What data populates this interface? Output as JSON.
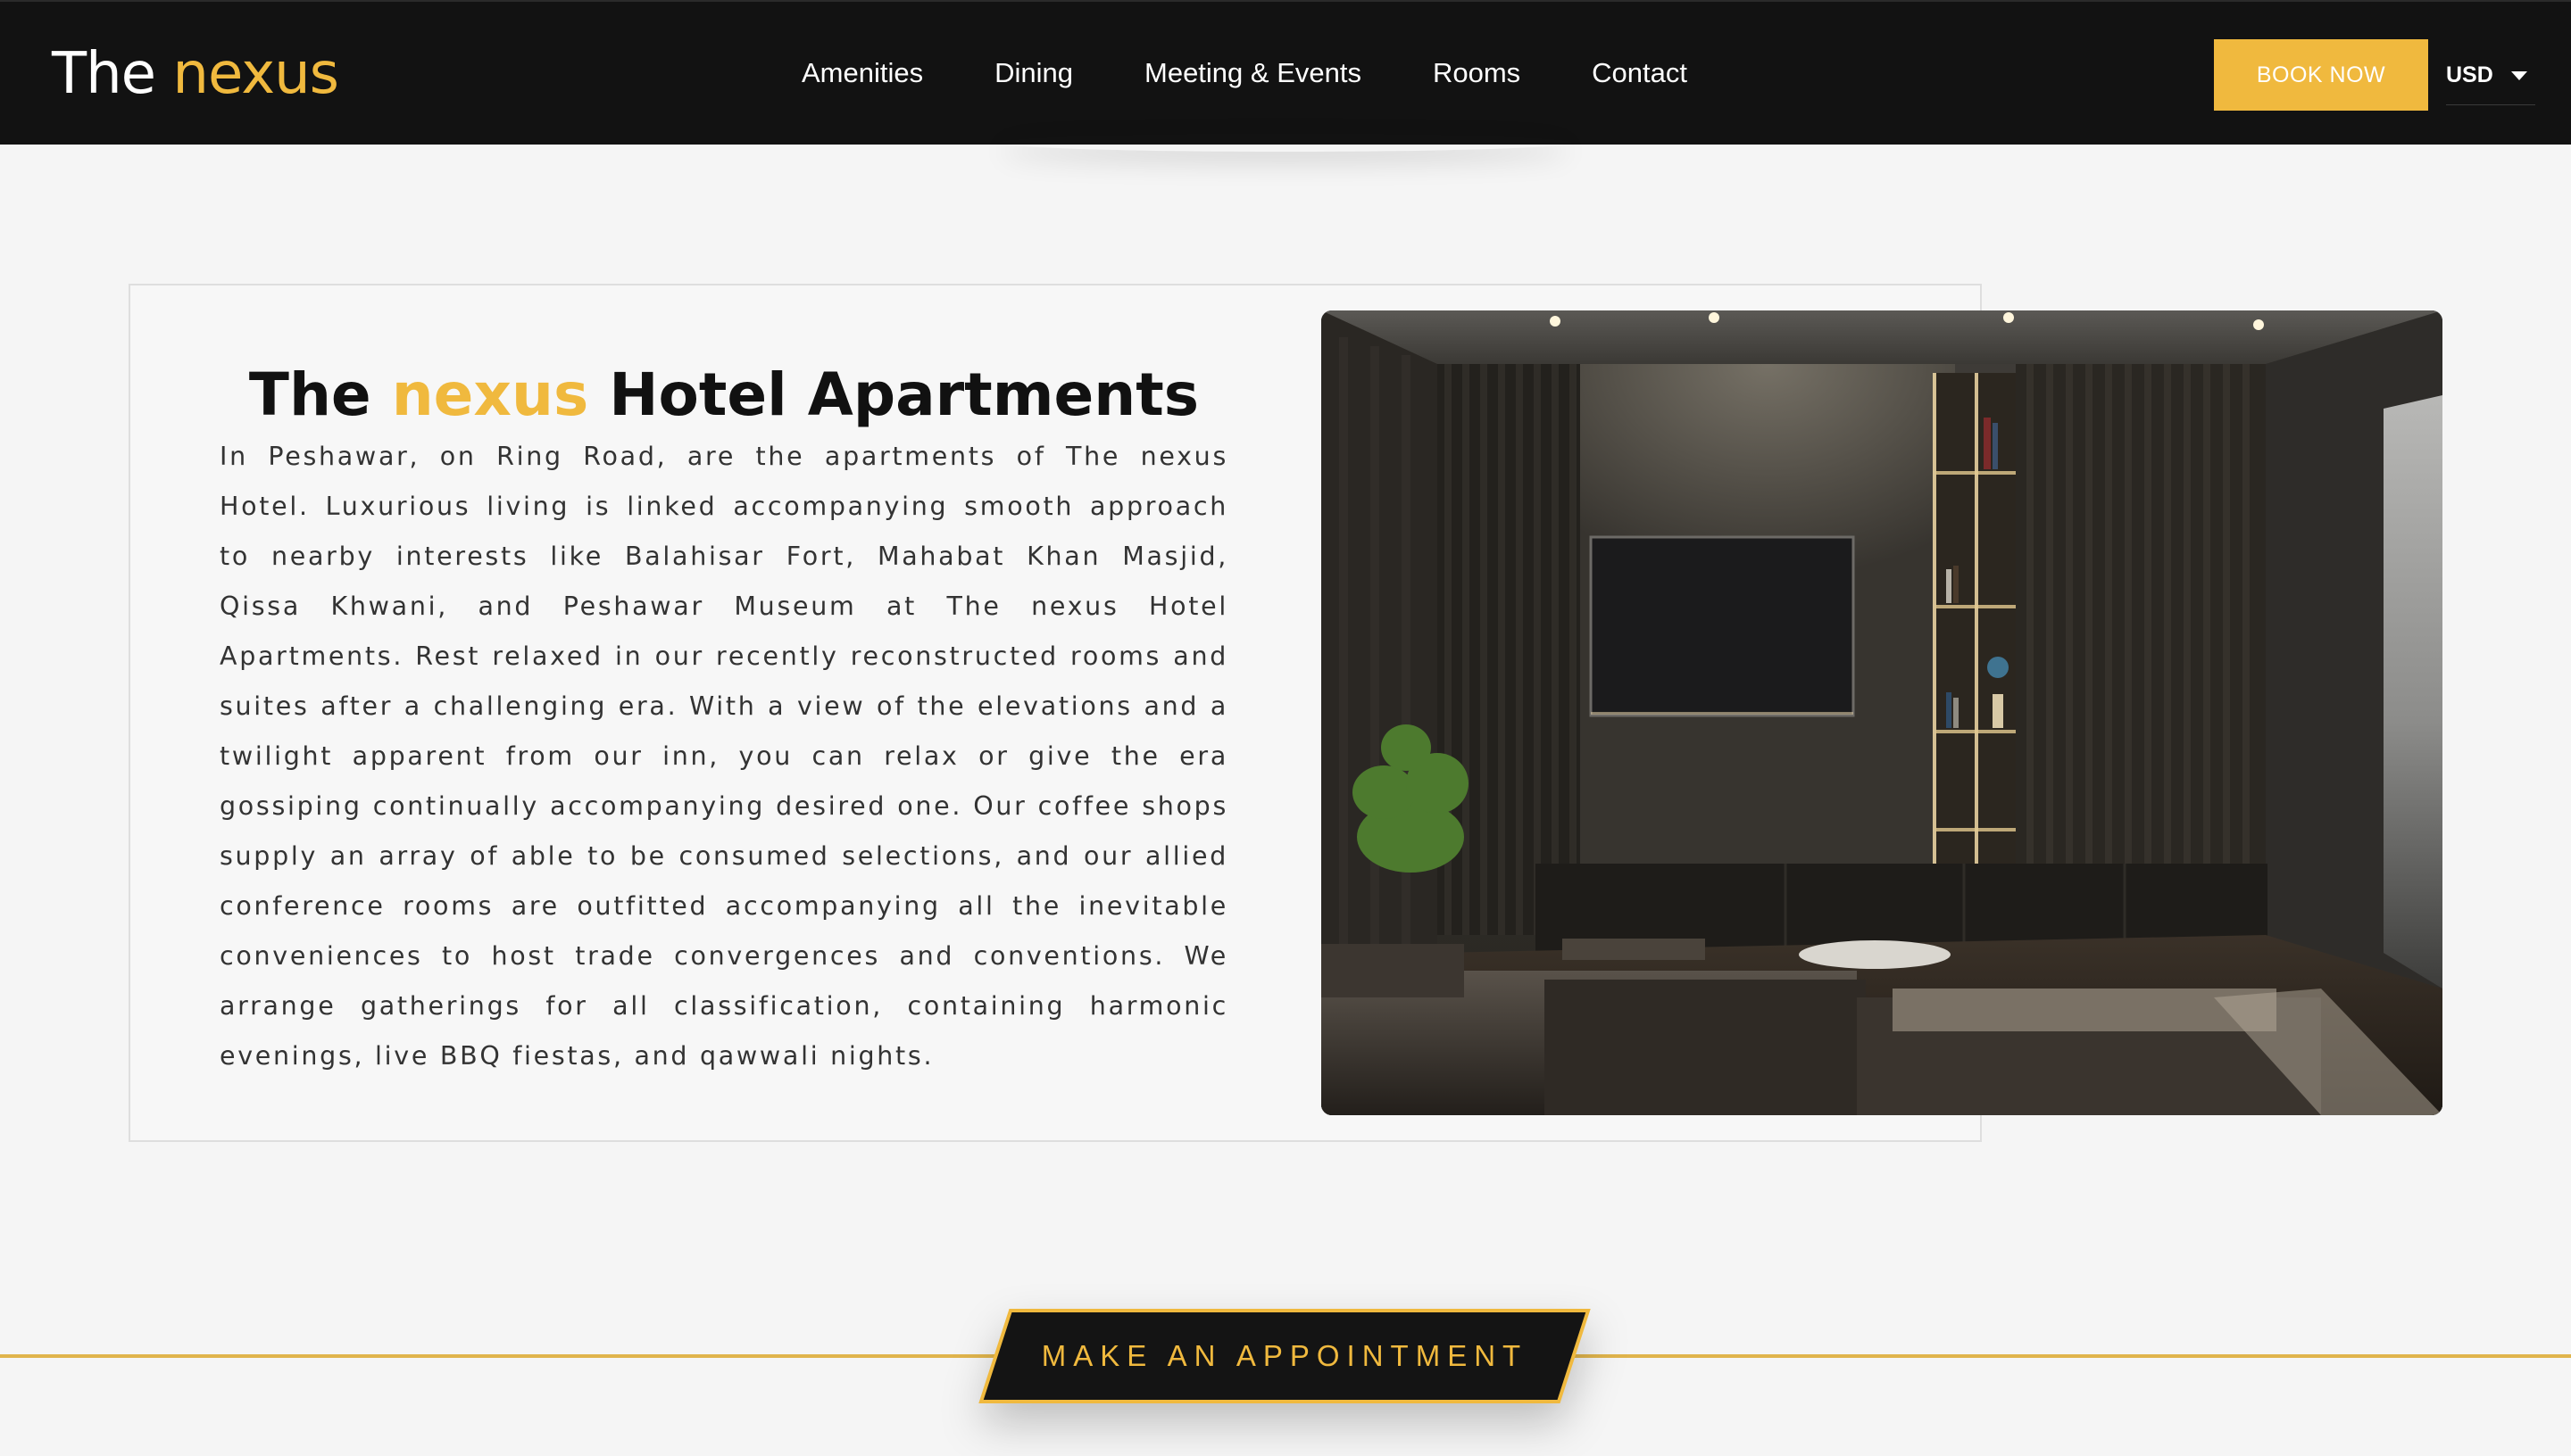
{
  "brand": {
    "first": "The",
    "accent": "nexus",
    "accent_color": "#f0b93e"
  },
  "nav": {
    "items": [
      {
        "label": "Amenities"
      },
      {
        "label": "Dining"
      },
      {
        "label": "Meeting & Events"
      },
      {
        "label": "Rooms"
      },
      {
        "label": "Contact"
      }
    ]
  },
  "header": {
    "book_label": "BOOK NOW",
    "currency": "USD",
    "background": "#121212"
  },
  "intro": {
    "title_first": "The",
    "title_accent": "nexus",
    "title_rest": "Hotel Apartments",
    "paragraph": "In Peshawar, on Ring Road, are the apartments of The nexus Hotel. Luxurious living is linked accompanying smooth approach to nearby interests like Balahisar Fort, Mahabat Khan Masjid, Qissa Khwani, and Peshawar Museum at The nexus Hotel Apartments. Rest relaxed in our recently reconstructed rooms and suites after a challenging era. With a view of the elevations and a twilight apparent from our inn, you can relax or give the era gossiping continually accompanying desired one. Our coffee shops supply an array of able to be consumed selections, and our allied conference rooms are outfitted accompanying all the inevitable conveniences to host trade convergences and conventions. We arrange gatherings for all classification, containing harmonic evenings, live BBQ fiestas, and qawwali nights.",
    "photo_icon": "living-room-photo"
  },
  "appointment": {
    "label": "MAKE AN APPOINTMENT"
  }
}
